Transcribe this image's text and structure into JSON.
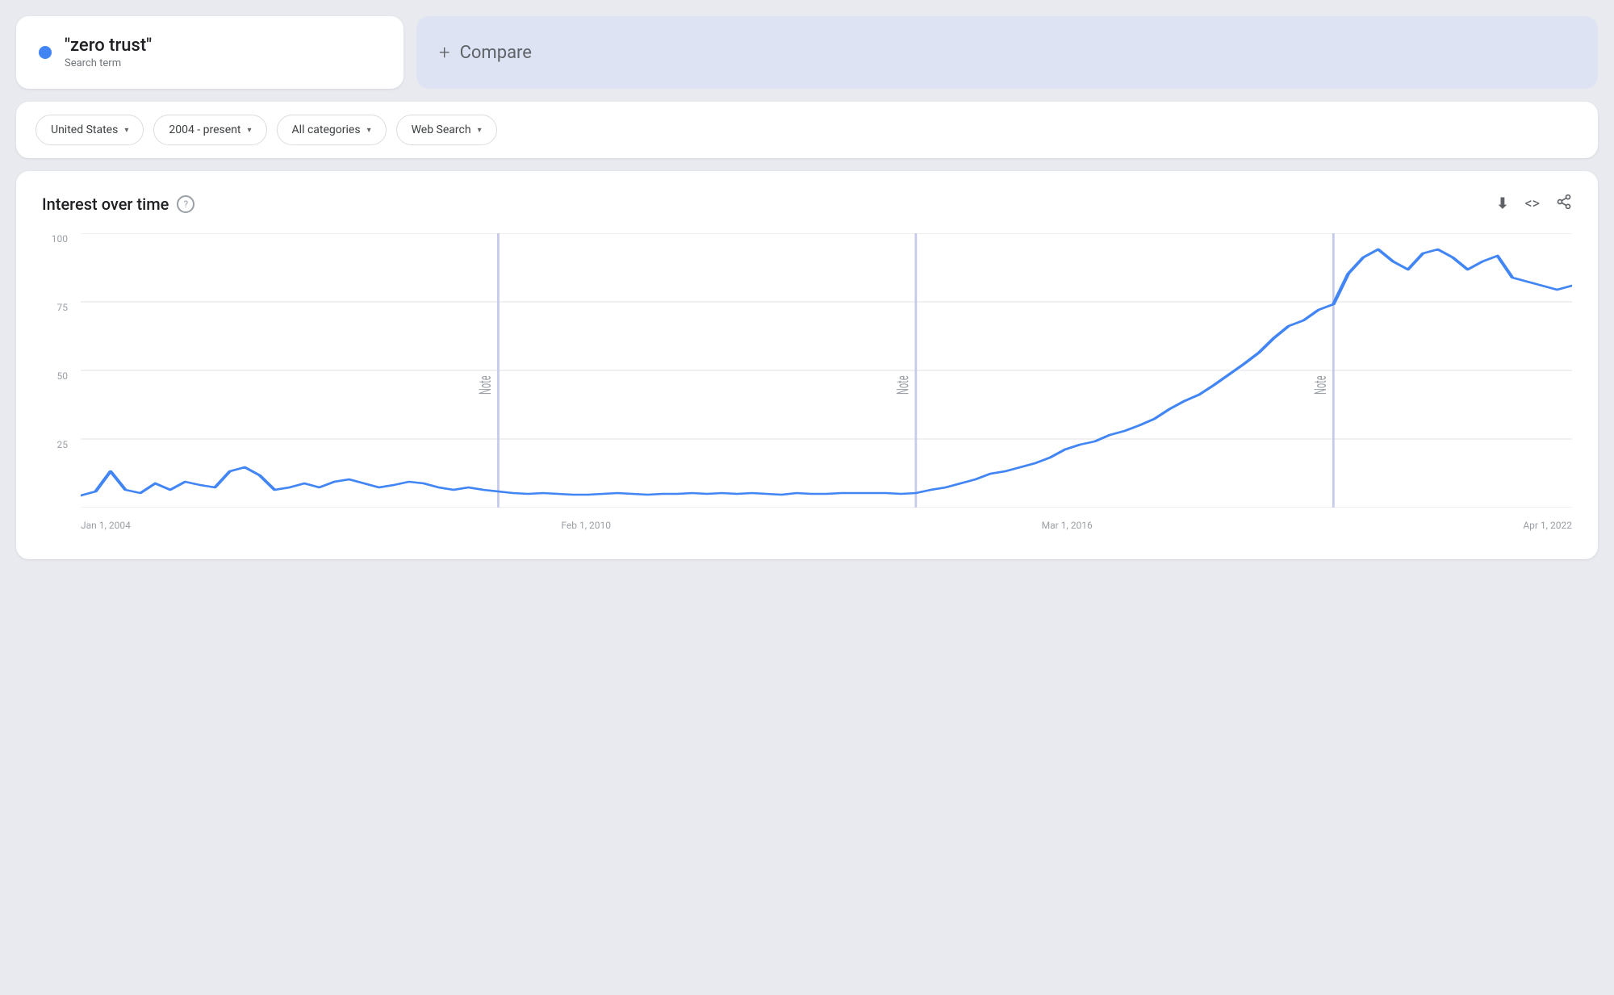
{
  "search_term": {
    "label": "\"zero trust\"",
    "sublabel": "Search term",
    "dot_color": "#4285f4"
  },
  "compare": {
    "label": "Compare",
    "plus": "+"
  },
  "filters": [
    {
      "id": "region",
      "label": "United States",
      "has_chevron": true
    },
    {
      "id": "time",
      "label": "2004 - present",
      "has_chevron": true
    },
    {
      "id": "category",
      "label": "All categories",
      "has_chevron": true
    },
    {
      "id": "search_type",
      "label": "Web Search",
      "has_chevron": true
    }
  ],
  "chart": {
    "title": "Interest over time",
    "y_labels": [
      "100",
      "75",
      "50",
      "25",
      ""
    ],
    "x_labels": [
      "Jan 1, 2004",
      "Feb 1, 2010",
      "Mar 1, 2016",
      "Apr 1, 2022"
    ],
    "notes": [
      {
        "label": "Note",
        "x_pct": 28
      },
      {
        "label": "Note",
        "x_pct": 56
      },
      {
        "label": "Note",
        "x_pct": 84
      }
    ],
    "download_icon": "↓",
    "embed_icon": "<>",
    "share_icon": "⤢"
  }
}
